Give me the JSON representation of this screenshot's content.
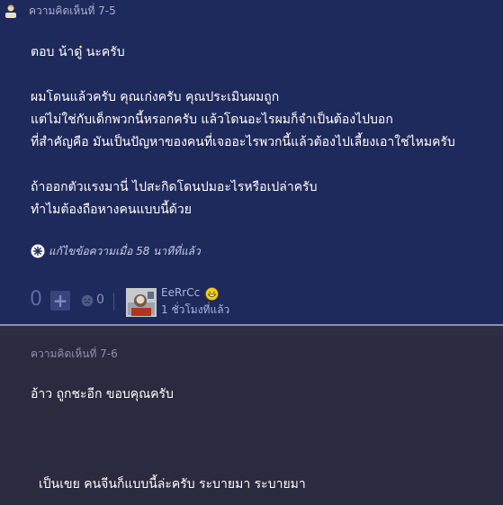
{
  "comment_75": {
    "header": "ความคิดเห็นที่ 7-5",
    "lines": [
      "ตอบ น้าดู๋ นะครับ",
      "ผมโดนแล้วครับ คุณเก่งครับ คุณประเมินผมถูก",
      "แต่ไม่ใช่กับเด็กพวกนี้หรอกครับ แล้วโดนอะไรผมก็จำเป็นต้องไปบอก",
      "ที่สำคัญคือ มันเป็นปัญหาของคนที่เจออะไรพวกนี้แล้วต้องไปเลี้ยงเอาใช่ไหมครับ",
      "ถ้าออกตัวแรงมานี่ ไปสะกิดโดนปมอะไรหรือเปล่าครับ",
      "ทำไมต้องถือหางคนแบบนี้ด้วย"
    ],
    "edit_note": "แก้ไขข้อความเมื่อ 58 นาทีที่แล้ว",
    "vote_count": "0",
    "emotion_count": "0",
    "user_name": "EeRrCc",
    "time_ago": "1 ชั่วโมงที่แล้ว"
  },
  "comment_76": {
    "header": "ความคิดเห็นที่ 7-6",
    "lines": [
      "อ้าว   ถูกชะอีก  ขอบคุณครับ",
      "เป็นเขย คนจีนก็แบบนี้ล่ะครับ  ระบายมา  ระบายมา"
    ]
  },
  "colors": {
    "comment_bg": "#1f2a5c",
    "page_bg": "#2b2b3f",
    "meta_text": "#aab3e0"
  },
  "icons": [
    "user-avatar-icon",
    "edit-flower-icon",
    "plus-icon",
    "emotion-icon",
    "grin-emoji-icon"
  ]
}
